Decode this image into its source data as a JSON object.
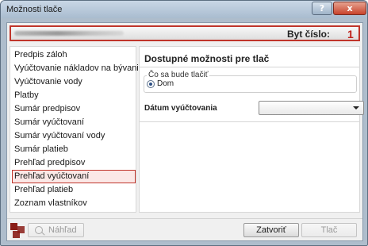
{
  "window": {
    "title": "Možnosti tlače"
  },
  "titlebar": {
    "help_glyph": "?",
    "close_glyph": "x"
  },
  "header": {
    "byt_label": "Byt číslo:",
    "byt_value": "1"
  },
  "left_list": {
    "items": [
      "Predpis záloh",
      "Vyúčtovanie nákladov na bývanie",
      "Vyúčtovanie vody",
      "Platby",
      "Sumár predpisov",
      "Sumár vyúčtovaní",
      "Sumár vyúčtovaní vody",
      "Sumár platieb",
      "Prehľad predpisov",
      "Prehľad vyúčtovaní",
      "Prehľad platieb",
      "Zoznam vlastníkov"
    ],
    "selected_index": 9
  },
  "options": {
    "title": "Dostupné možnosti pre tlač",
    "print_group_legend": "Čo sa bude tlačiť",
    "radio_label": "Dom",
    "date_label": "Dátum vyúčtovania",
    "date_value": ""
  },
  "footer": {
    "preview_label": "Náhľad",
    "close_label": "Zatvoriť",
    "print_label": "Tlač"
  },
  "colors": {
    "accent": "#c0352b",
    "value_red": "#c0221b"
  }
}
